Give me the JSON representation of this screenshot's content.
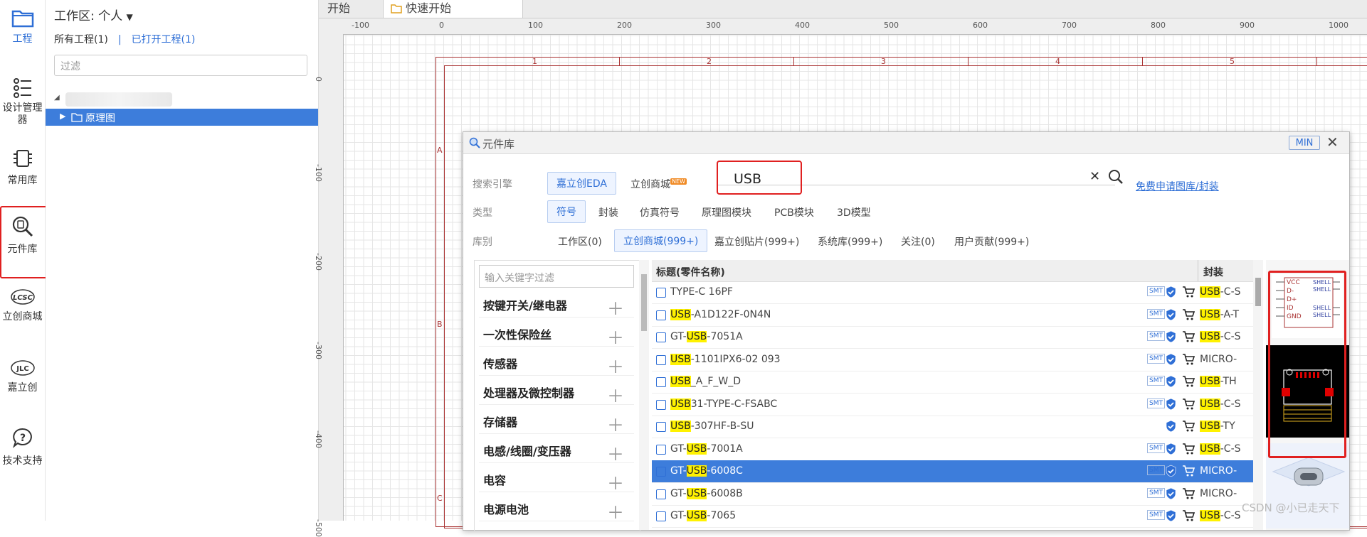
{
  "rail": {
    "items": [
      {
        "label": "工程",
        "icon": "folder-icon"
      },
      {
        "label": "设计管理器",
        "icon": "list-icon"
      },
      {
        "label": "常用库",
        "icon": "chip-icon"
      },
      {
        "label": "元件库",
        "icon": "chip-search-icon"
      },
      {
        "label": "立创商城",
        "icon": "lcsc-logo-icon"
      },
      {
        "label": "嘉立创",
        "icon": "jlc-logo-icon"
      },
      {
        "label": "技术支持",
        "icon": "help-icon"
      }
    ]
  },
  "project": {
    "workspace_title": "工作区: 个人",
    "tab_all": "所有工程(1)",
    "tab_separator": "|",
    "tab_open": "已打开工程(1)",
    "filter_placeholder": "过滤",
    "tree_selected": "原理图"
  },
  "doc_tabs": [
    "开始",
    "快速开始"
  ],
  "ruler_top": [
    "-100",
    "0",
    "100",
    "200",
    "300",
    "400",
    "500",
    "600",
    "700",
    "800",
    "900",
    "1000"
  ],
  "ruler_left": [
    "0",
    "-100",
    "-200",
    "-300",
    "-400",
    "-500"
  ],
  "frame_cols": [
    "1",
    "2",
    "3",
    "4",
    "5"
  ],
  "frame_rows": [
    "A",
    "B",
    "C"
  ],
  "dialog": {
    "title": "元件库",
    "min_label": "MIN",
    "search_engine_label": "搜索引擎",
    "engine_options": [
      "嘉立创EDA",
      "立创商城"
    ],
    "new_badge": "NEW",
    "search_value": "USB",
    "apply_link": "免费申请图库/封装",
    "type_label": "类型",
    "type_options": [
      "符号",
      "封装",
      "仿真符号",
      "原理图模块",
      "PCB模块",
      "3D模型"
    ],
    "lib_label": "库别",
    "lib_options": [
      "工作区(0)",
      "立创商城(999+)",
      "嘉立创贴片(999+)",
      "系统库(999+)",
      "关注(0)",
      "用户贡献(999+)"
    ],
    "category_filter_placeholder": "输入关键字过滤",
    "categories": [
      "按键开关/继电器",
      "一次性保险丝",
      "传感器",
      "处理器及微控制器",
      "存储器",
      "电感/线圈/变压器",
      "电容",
      "电源电池"
    ],
    "columns": {
      "title": "标题(零件名称)",
      "package": "封装"
    },
    "rows": [
      {
        "pre": "TYPE-C 16PF",
        "hl": "",
        "post": "",
        "pkg_hl": "USB",
        "pkg_post": "-C-S",
        "smt": true
      },
      {
        "pre": "",
        "hl": "USB",
        "post": "-A1D122F-0N4N",
        "pkg_hl": "USB",
        "pkg_post": "-A-T",
        "smt": true
      },
      {
        "pre": "GT-",
        "hl": "USB",
        "post": "-7051A",
        "pkg_hl": "USB",
        "pkg_post": "-C-S",
        "smt": true
      },
      {
        "pre": "",
        "hl": "USB",
        "post": "-1101IPX6-02 093",
        "pkg_hl": "",
        "pkg_post": "MICRO-",
        "smt": true
      },
      {
        "pre": "",
        "hl": "USB",
        "post": "_A_F_W_D",
        "pkg_hl": "USB",
        "pkg_post": "-TH",
        "smt": true
      },
      {
        "pre": "",
        "hl": "USB",
        "post": "31-TYPE-C-FSABC",
        "pkg_hl": "USB",
        "pkg_post": "-C-S",
        "smt": true
      },
      {
        "pre": "",
        "hl": "USB",
        "post": "-307HF-B-SU",
        "pkg_hl": "USB",
        "pkg_post": "-TY",
        "smt": false
      },
      {
        "pre": "GT-",
        "hl": "USB",
        "post": "-7001A",
        "pkg_hl": "USB",
        "pkg_post": "-C-S",
        "smt": true
      },
      {
        "pre": "GT-",
        "hl": "USB",
        "post": "-6008C",
        "pkg_hl": "",
        "pkg_post": "MICRO-",
        "smt": true,
        "selected": true
      },
      {
        "pre": "GT-",
        "hl": "USB",
        "post": "-6008B",
        "pkg_hl": "",
        "pkg_post": "MICRO-",
        "smt": true
      },
      {
        "pre": "GT-",
        "hl": "USB",
        "post": "-7065",
        "pkg_hl": "USB",
        "pkg_post": "-C-S",
        "smt": true
      }
    ],
    "symbol_pins_left": [
      "VCC",
      "D-",
      "D+",
      "ID",
      "GND"
    ],
    "symbol_pins_right": [
      "SHELL",
      "SHELL",
      "SHELL",
      "SHELL"
    ]
  },
  "watermark": "CSDN @小已走天下",
  "colors": {
    "accent": "#2f6fd6",
    "highlight": "#fff200",
    "selection": "#3d7ddb",
    "frame": "#aa3333",
    "annotation": "#e02020"
  }
}
